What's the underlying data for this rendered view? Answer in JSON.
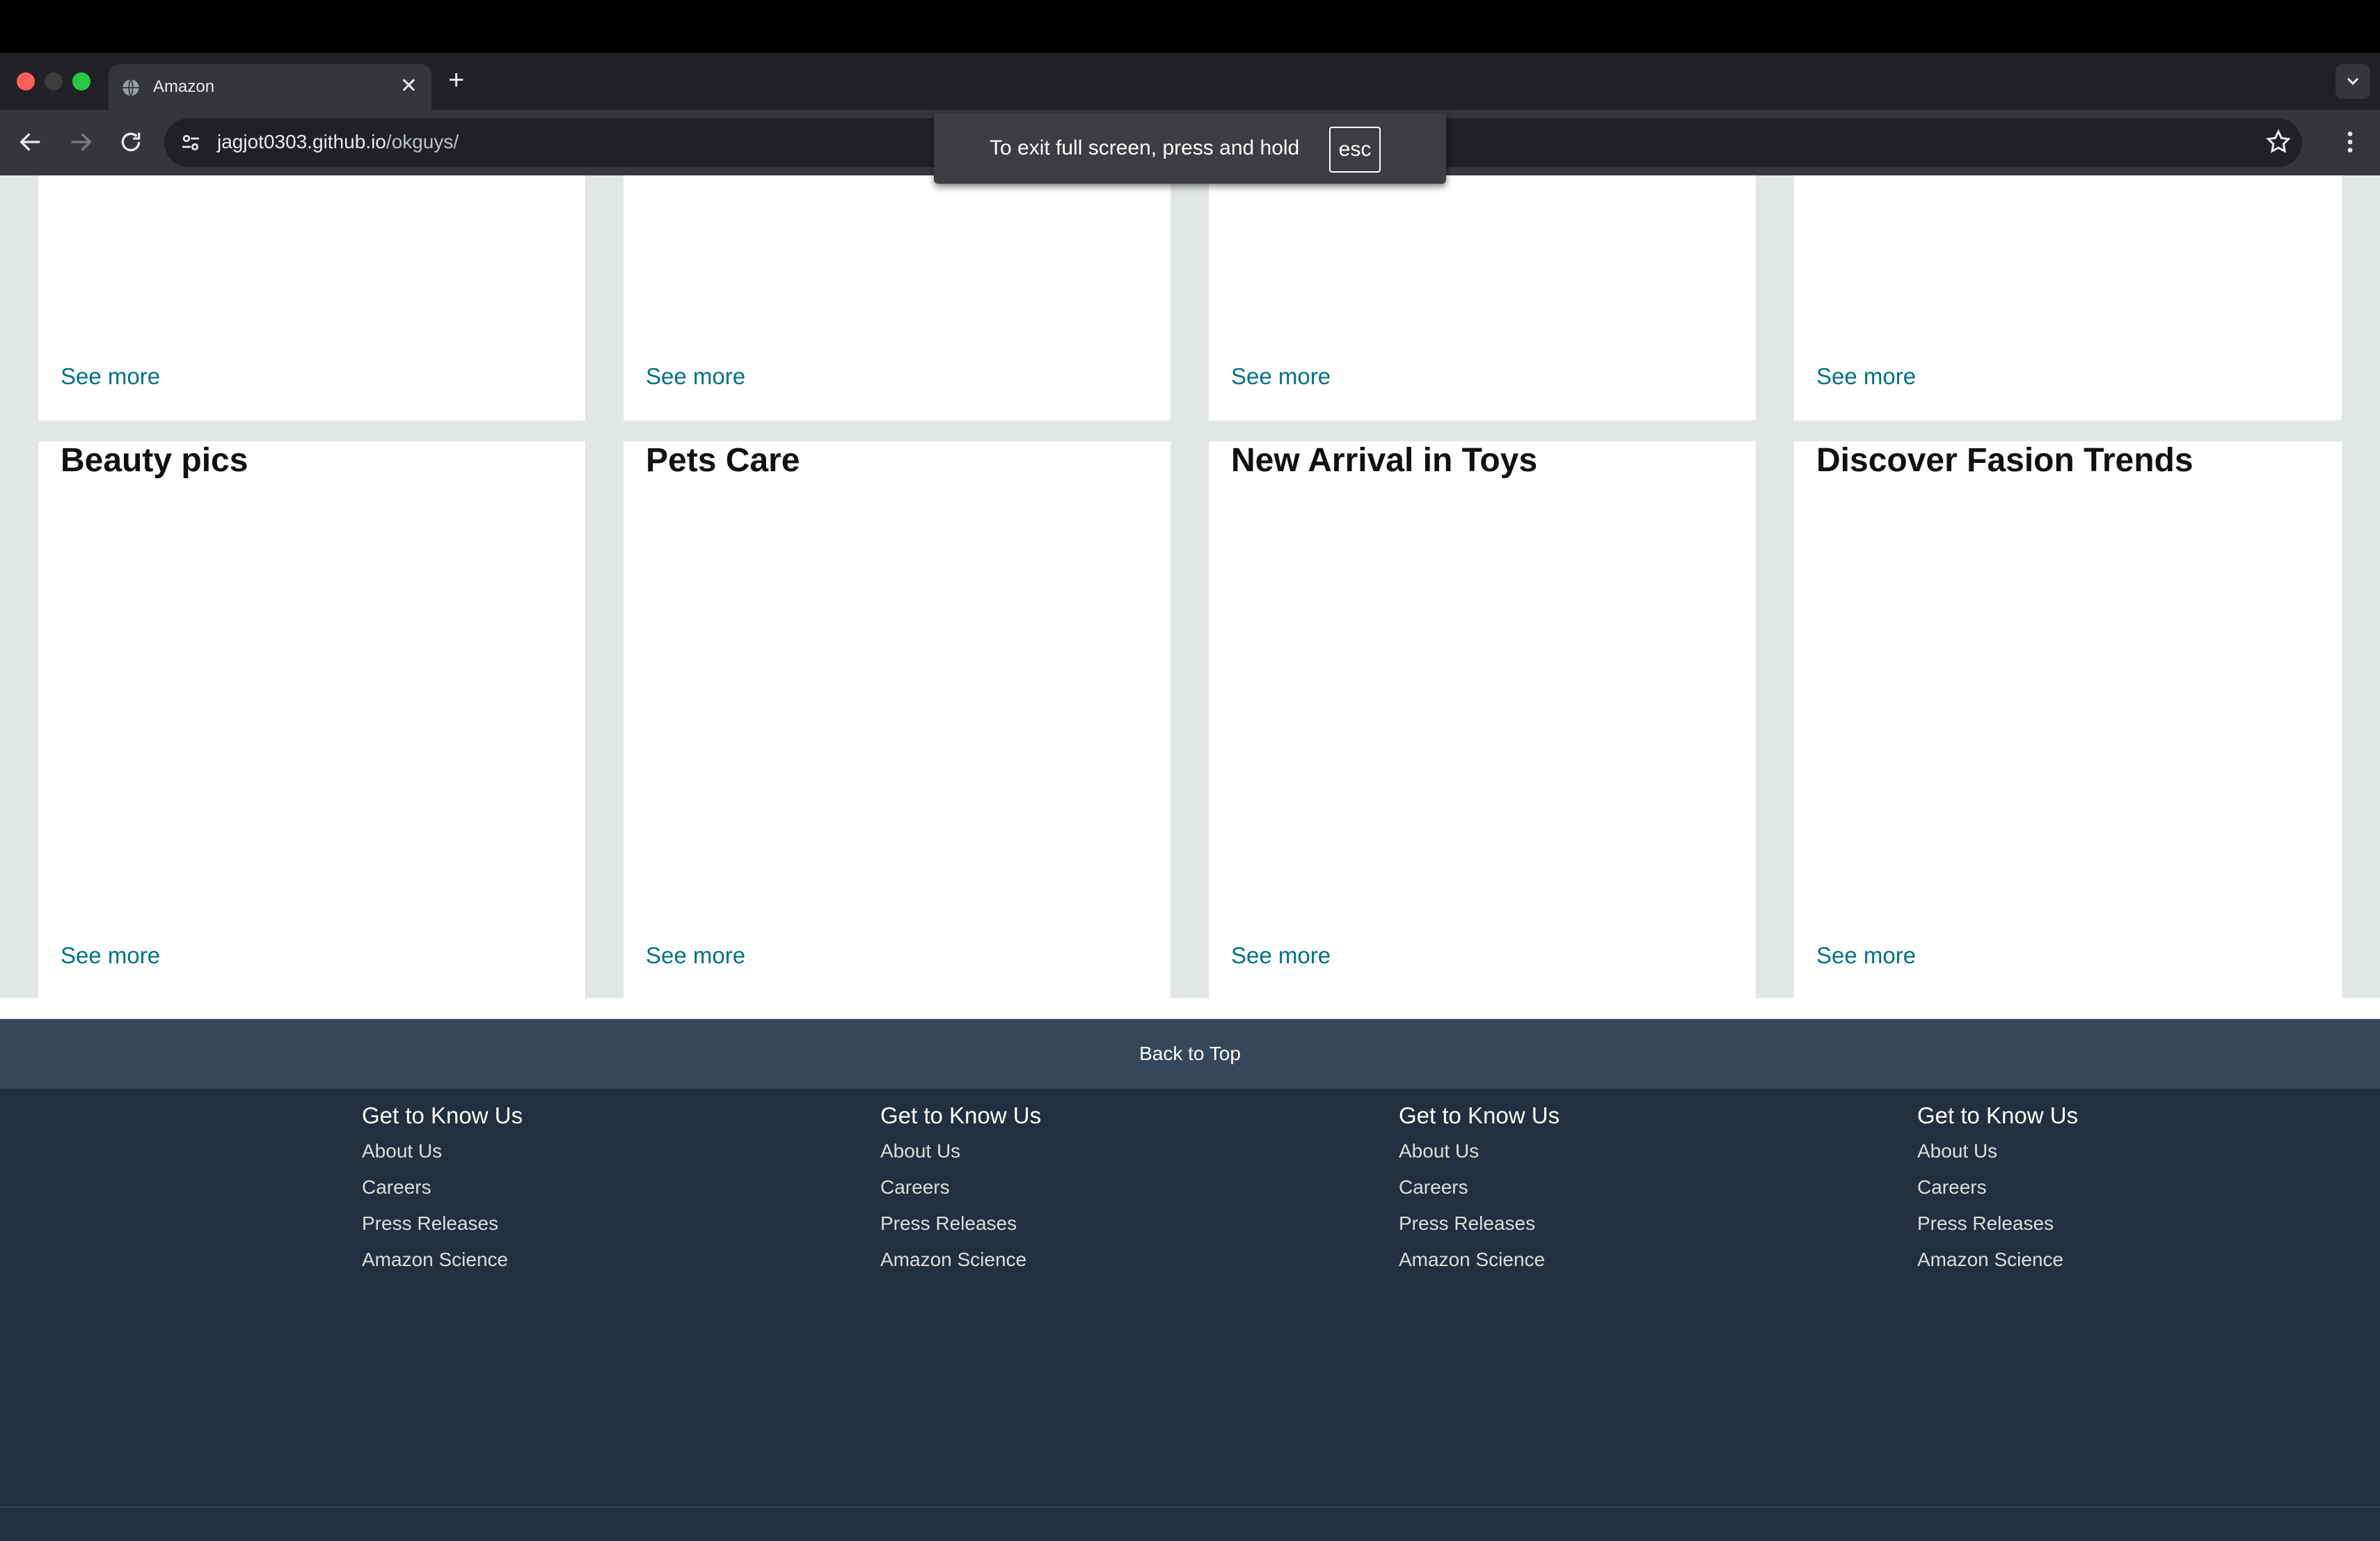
{
  "browser": {
    "tab_title": "Amazon",
    "close_glyph": "✕",
    "new_tab_glyph": "+",
    "url_host": "jagjot0303.github.io",
    "url_path": "/okguys/"
  },
  "fullscreen_notice": {
    "text": "To exit full screen, press and hold",
    "key": "esc"
  },
  "cards_top_row": [
    {
      "link": "See more"
    },
    {
      "link": "See more"
    },
    {
      "link": "See more"
    },
    {
      "link": "See more"
    }
  ],
  "cards_bottom_row": [
    {
      "title": "Beauty pics",
      "link": "See more"
    },
    {
      "title": "Pets Care",
      "link": "See more"
    },
    {
      "title": "New Arrival in Toys",
      "link": "See more"
    },
    {
      "title": "Discover Fasion Trends",
      "link": "See more"
    }
  ],
  "back_to_top": "Back to Top",
  "footer": {
    "columns": [
      {
        "heading": "Get to Know Us",
        "links": [
          "About Us",
          "Careers",
          "Press Releases",
          "Amazon Science"
        ]
      },
      {
        "heading": "Get to Know Us",
        "links": [
          "About Us",
          "Careers",
          "Press Releases",
          "Amazon Science"
        ]
      },
      {
        "heading": "Get to Know Us",
        "links": [
          "About Us",
          "Careers",
          "Press Releases",
          "Amazon Science"
        ]
      },
      {
        "heading": "Get to Know Us",
        "links": [
          "About Us",
          "Careers",
          "Press Releases",
          "Amazon Science"
        ]
      }
    ]
  },
  "colors": {
    "link": "#007185",
    "back_to_top_bg": "#37475a",
    "footer_bg": "#232f3e",
    "page_bg": "#e3e6e6"
  }
}
